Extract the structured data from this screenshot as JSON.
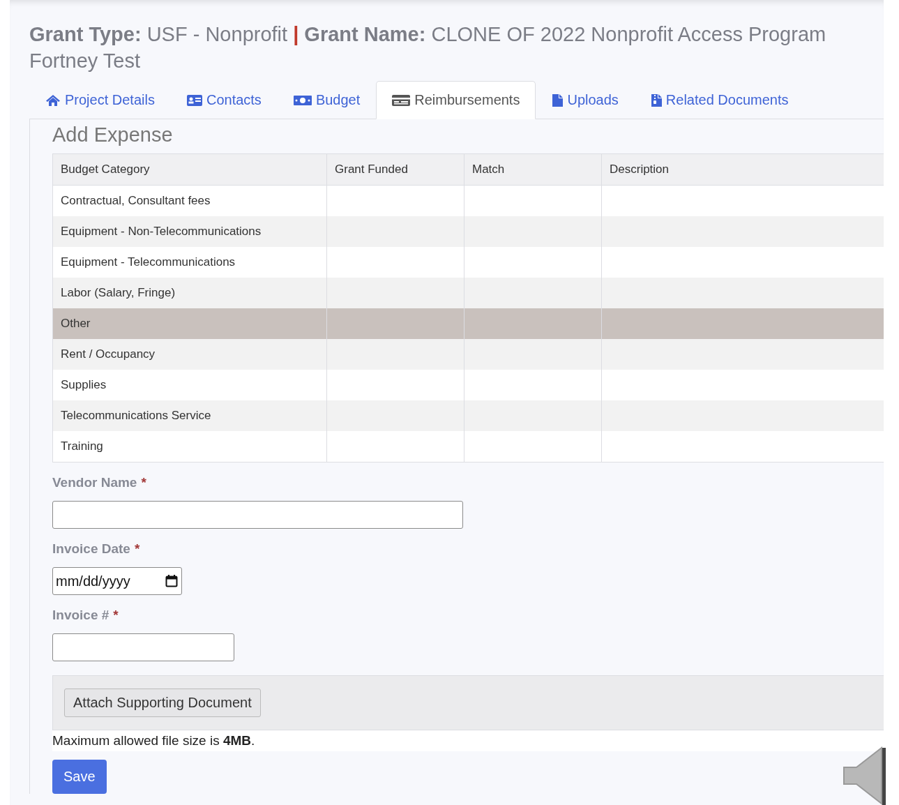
{
  "header": {
    "grant_type_label": "Grant Type:",
    "grant_type": "USF - Nonprofit",
    "separator": "|",
    "grant_name_label": "Grant Name:",
    "grant_name": "CLONE OF 2022 Nonprofit Access Program Fortney Test"
  },
  "tabs": [
    {
      "label": "Project Details",
      "kind": "house",
      "selected": false
    },
    {
      "label": "Contacts",
      "kind": "card",
      "selected": false
    },
    {
      "label": "Budget",
      "kind": "money",
      "selected": false
    },
    {
      "label": "Reimbursements",
      "kind": "receipt",
      "selected": true
    },
    {
      "label": "Uploads",
      "kind": "file",
      "selected": false
    },
    {
      "label": "Related Documents",
      "kind": "archive",
      "selected": false
    }
  ],
  "section_title": "Add Expense",
  "table": {
    "columns": [
      "Budget Category",
      "Grant Funded",
      "Match",
      "Description"
    ],
    "rows": [
      {
        "category": "Contractual, Consultant fees",
        "selected": false
      },
      {
        "category": "Equipment - Non-Telecommunications",
        "selected": false
      },
      {
        "category": "Equipment - Telecommunications",
        "selected": false
      },
      {
        "category": "Labor (Salary, Fringe)",
        "selected": false
      },
      {
        "category": "Other",
        "selected": true
      },
      {
        "category": "Rent / Occupancy",
        "selected": false
      },
      {
        "category": "Supplies",
        "selected": false
      },
      {
        "category": "Telecommunications Service",
        "selected": false
      },
      {
        "category": "Training",
        "selected": false
      }
    ]
  },
  "fields": [
    {
      "label": "Vendor Name",
      "required_mark": "*",
      "kind": "text"
    },
    {
      "label": "Invoice Date",
      "required_mark": "*",
      "kind": "date",
      "placeholder": "mm/dd/yyyy"
    },
    {
      "label": "Invoice #",
      "required_mark": "*",
      "kind": "short"
    }
  ],
  "attach_button": "Attach Supporting Document",
  "file_note": "Maximum allowed file size is **4MB**.",
  "save_button": "Save"
}
